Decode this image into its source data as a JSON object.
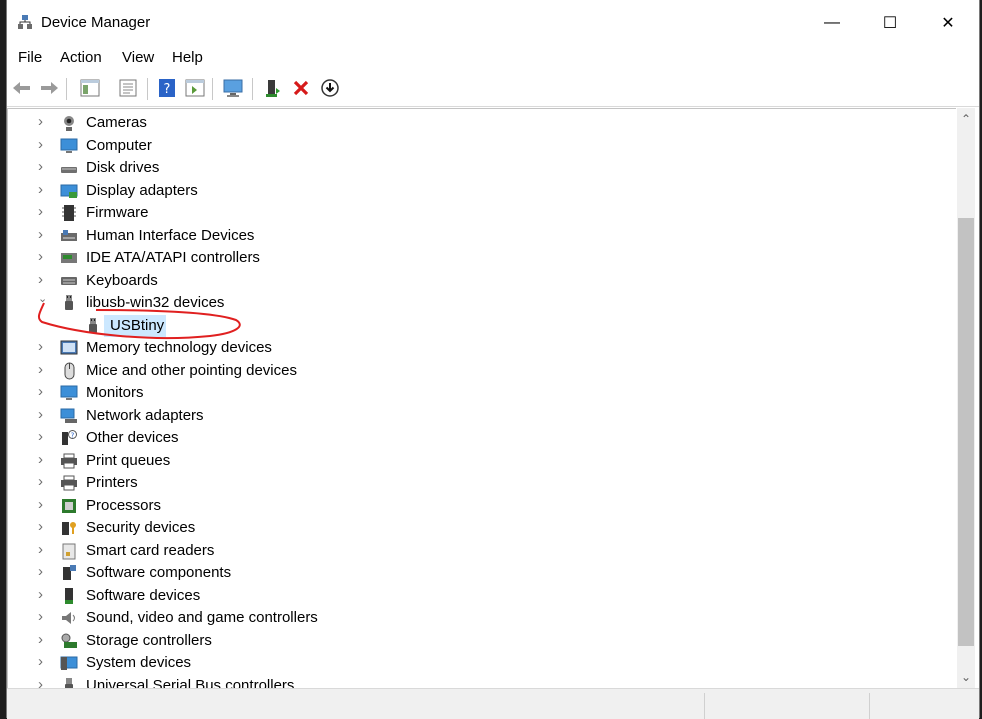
{
  "window": {
    "title": "Device Manager"
  },
  "title_buttons": {
    "minimize": "—",
    "maximize": "☐",
    "close": "✕"
  },
  "menu": [
    "File",
    "Action",
    "View",
    "Help"
  ],
  "toolbar": [
    "back",
    "forward",
    "show-hide-console-tree",
    "properties",
    "help",
    "update",
    "scan-hardware",
    "enable-device",
    "uninstall-device",
    "update-driver"
  ],
  "tree": [
    {
      "label": "Cameras",
      "icon": "camera-icon",
      "expanded": false
    },
    {
      "label": "Computer",
      "icon": "computer-icon",
      "expanded": false
    },
    {
      "label": "Disk drives",
      "icon": "disk-drive-icon",
      "expanded": false
    },
    {
      "label": "Display adapters",
      "icon": "display-adapter-icon",
      "expanded": false
    },
    {
      "label": "Firmware",
      "icon": "firmware-icon",
      "expanded": false
    },
    {
      "label": "Human Interface Devices",
      "icon": "hid-icon",
      "expanded": false
    },
    {
      "label": "IDE ATA/ATAPI controllers",
      "icon": "ide-controller-icon",
      "expanded": false
    },
    {
      "label": "Keyboards",
      "icon": "keyboard-icon",
      "expanded": false
    },
    {
      "label": "libusb-win32 devices",
      "icon": "usb-plug-icon",
      "expanded": true,
      "children": [
        {
          "label": "USBtiny",
          "icon": "usb-plug-icon",
          "selected": true
        }
      ]
    },
    {
      "label": "Memory technology devices",
      "icon": "memory-device-icon",
      "expanded": false
    },
    {
      "label": "Mice and other pointing devices",
      "icon": "mouse-icon",
      "expanded": false
    },
    {
      "label": "Monitors",
      "icon": "monitor-icon",
      "expanded": false
    },
    {
      "label": "Network adapters",
      "icon": "network-adapter-icon",
      "expanded": false
    },
    {
      "label": "Other devices",
      "icon": "other-devices-icon",
      "expanded": false
    },
    {
      "label": "Print queues",
      "icon": "print-queue-icon",
      "expanded": false
    },
    {
      "label": "Printers",
      "icon": "printer-icon",
      "expanded": false
    },
    {
      "label": "Processors",
      "icon": "processor-icon",
      "expanded": false
    },
    {
      "label": "Security devices",
      "icon": "security-device-icon",
      "expanded": false
    },
    {
      "label": "Smart card readers",
      "icon": "smart-card-icon",
      "expanded": false
    },
    {
      "label": "Software components",
      "icon": "software-component-icon",
      "expanded": false
    },
    {
      "label": "Software devices",
      "icon": "software-device-icon",
      "expanded": false
    },
    {
      "label": "Sound, video and game controllers",
      "icon": "speaker-icon",
      "expanded": false
    },
    {
      "label": "Storage controllers",
      "icon": "storage-controller-icon",
      "expanded": false
    },
    {
      "label": "System devices",
      "icon": "system-device-icon",
      "expanded": false
    },
    {
      "label": "Universal Serial Bus controllers",
      "icon": "usb-controller-icon",
      "expanded": false
    }
  ],
  "colors": {
    "selection": "#cce8ff",
    "annotation": "#e02020",
    "scroll_thumb": "#c2c2c2"
  }
}
